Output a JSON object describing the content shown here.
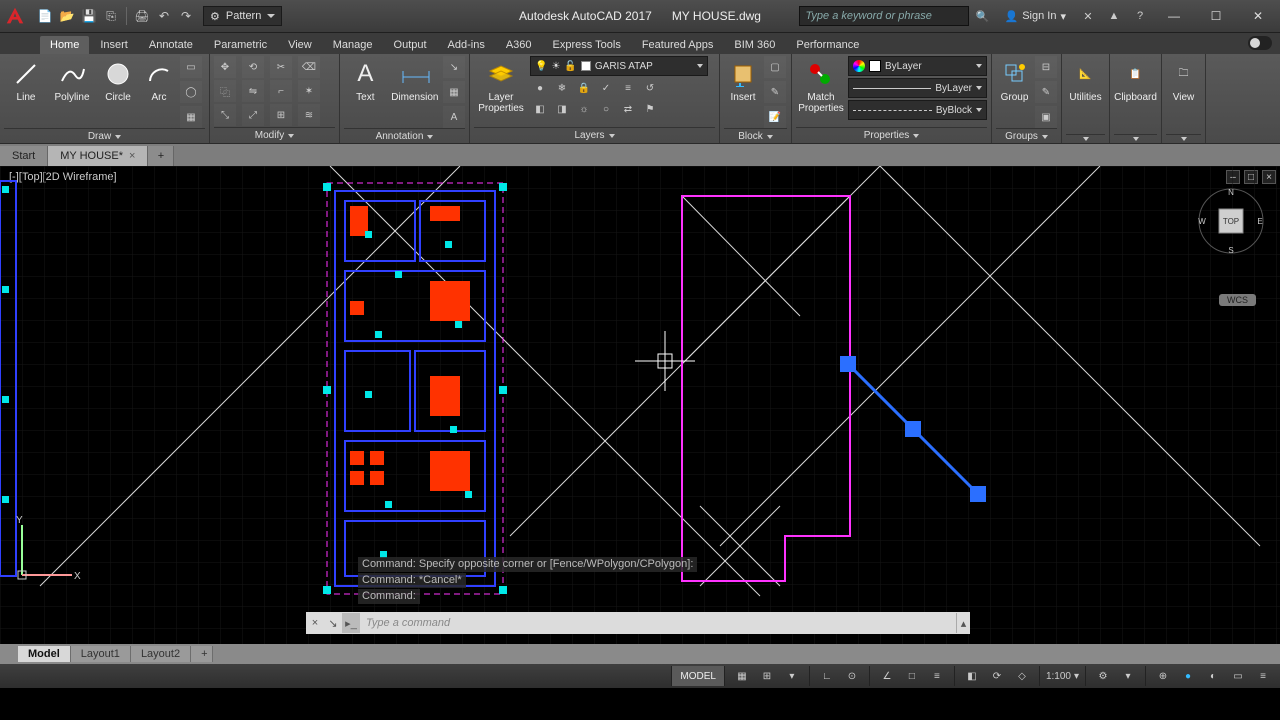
{
  "titlebar": {
    "app": "Autodesk AutoCAD 2017",
    "document": "MY HOUSE.dwg",
    "workspace": "Pattern",
    "search_placeholder": "Type a keyword or phrase",
    "signin": "Sign In"
  },
  "tabs": [
    "Home",
    "Insert",
    "Annotate",
    "Parametric",
    "View",
    "Manage",
    "Output",
    "Add-ins",
    "A360",
    "Express Tools",
    "Featured Apps",
    "BIM 360",
    "Performance"
  ],
  "active_tab": "Home",
  "ribbon": {
    "draw": {
      "title": "Draw",
      "line": "Line",
      "polyline": "Polyline",
      "circle": "Circle",
      "arc": "Arc"
    },
    "modify": {
      "title": "Modify"
    },
    "annotation": {
      "title": "Annotation",
      "text": "Text",
      "dimension": "Dimension"
    },
    "layers": {
      "title": "Layers",
      "layer_properties": "Layer\nProperties",
      "current_layer": "GARIS ATAP"
    },
    "block": {
      "title": "Block",
      "insert": "Insert"
    },
    "properties": {
      "title": "Properties",
      "match": "Match\nProperties",
      "color": "ByLayer",
      "line1": "ByLayer",
      "line2": "ByBlock"
    },
    "groups": {
      "title": "Groups",
      "group": "Group"
    },
    "utilities": {
      "title": "",
      "utilities": "Utilities"
    },
    "clipboard": {
      "title": "",
      "clipboard": "Clipboard"
    },
    "view": {
      "title": "",
      "view": "View"
    }
  },
  "file_tabs": {
    "start": "Start",
    "doc": "MY HOUSE*"
  },
  "viewport": {
    "label": "[-][Top][2D Wireframe]",
    "cube": {
      "top": "TOP",
      "n": "N",
      "s": "S",
      "e": "E",
      "w": "W"
    },
    "wcs": "WCS"
  },
  "command": {
    "history": [
      "Command: Specify opposite corner or [Fence/WPolygon/CPolygon]:",
      "Command: *Cancel*",
      "Command:"
    ],
    "placeholder": "Type a command"
  },
  "layout_tabs": [
    "Model",
    "Layout1",
    "Layout2"
  ],
  "status": {
    "space": "MODEL",
    "scale": "1:100"
  }
}
